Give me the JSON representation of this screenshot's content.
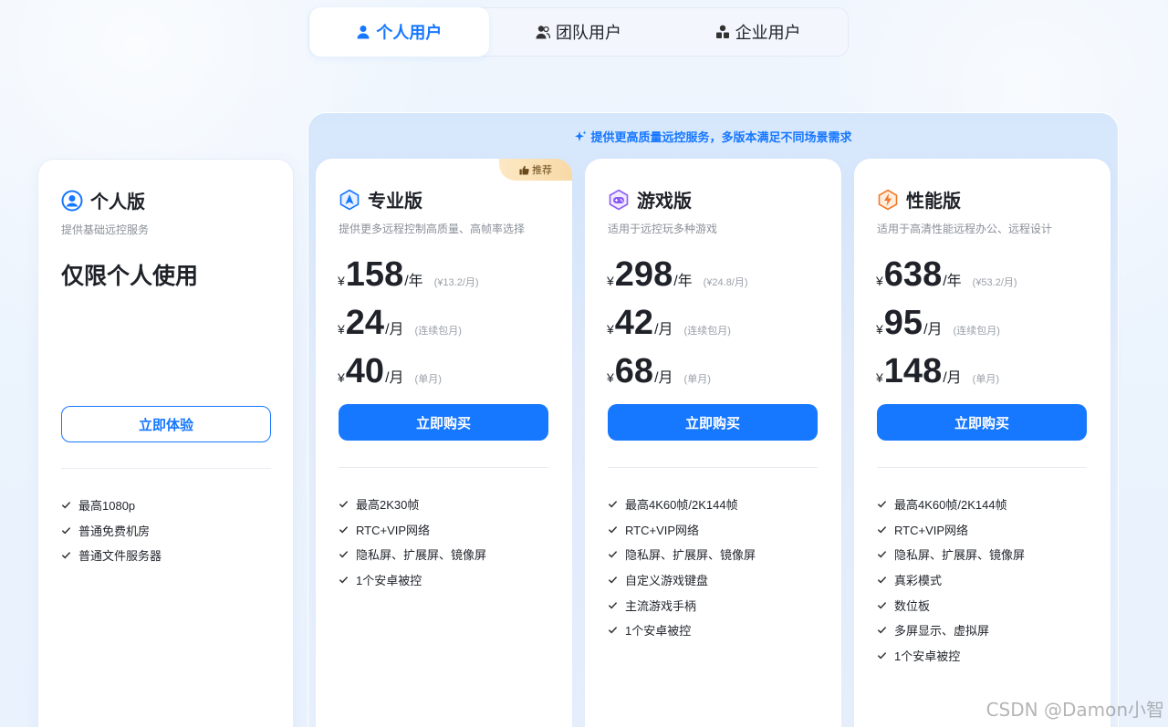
{
  "tabs": [
    {
      "label": "个人用户",
      "active": true,
      "icon": "user-icon"
    },
    {
      "label": "团队用户",
      "active": false,
      "icon": "team-icon"
    },
    {
      "label": "企业用户",
      "active": false,
      "icon": "enterprise-icon"
    }
  ],
  "banner": "提供更高质量远控服务，多版本满足不同场景需求",
  "colors": {
    "accent": "#1677ff"
  },
  "basic": {
    "title": "个人版",
    "subtitle": "提供基础远控服务",
    "headline": "仅限个人使用",
    "button": "立即体验",
    "features": [
      "最高1080p",
      "普通免费机房",
      "普通文件服务器"
    ]
  },
  "pro": {
    "title": "专业版",
    "badge": "推荐",
    "subtitle": "提供更多远程控制高质量、高帧率选择",
    "prices": [
      {
        "currency": "¥",
        "amount": "158",
        "unit": "/年",
        "note": "(¥13.2/月)"
      },
      {
        "currency": "¥",
        "amount": "24",
        "unit": "/月",
        "note": "(连续包月)"
      },
      {
        "currency": "¥",
        "amount": "40",
        "unit": "/月",
        "note": "(单月)"
      }
    ],
    "button": "立即购买",
    "features": [
      "最高2K30帧",
      "RTC+VIP网络",
      "隐私屏、扩展屏、镜像屏",
      "1个安卓被控"
    ]
  },
  "game": {
    "title": "游戏版",
    "subtitle": "适用于远控玩多种游戏",
    "prices": [
      {
        "currency": "¥",
        "amount": "298",
        "unit": "/年",
        "note": "(¥24.8/月)"
      },
      {
        "currency": "¥",
        "amount": "42",
        "unit": "/月",
        "note": "(连续包月)"
      },
      {
        "currency": "¥",
        "amount": "68",
        "unit": "/月",
        "note": "(单月)"
      }
    ],
    "button": "立即购买",
    "features": [
      "最高4K60帧/2K144帧",
      "RTC+VIP网络",
      "隐私屏、扩展屏、镜像屏",
      "自定义游戏键盘",
      "主流游戏手柄",
      "1个安卓被控"
    ]
  },
  "perf": {
    "title": "性能版",
    "subtitle": "适用于高清性能远程办公、远程设计",
    "prices": [
      {
        "currency": "¥",
        "amount": "638",
        "unit": "/年",
        "note": "(¥53.2/月)"
      },
      {
        "currency": "¥",
        "amount": "95",
        "unit": "/月",
        "note": "(连续包月)"
      },
      {
        "currency": "¥",
        "amount": "148",
        "unit": "/月",
        "note": "(单月)"
      }
    ],
    "button": "立即购买",
    "features": [
      "最高4K60帧/2K144帧",
      "RTC+VIP网络",
      "隐私屏、扩展屏、镜像屏",
      "真彩模式",
      "数位板",
      "多屏显示、虚拟屏",
      "1个安卓被控"
    ]
  },
  "watermark": "CSDN @Damon小智"
}
